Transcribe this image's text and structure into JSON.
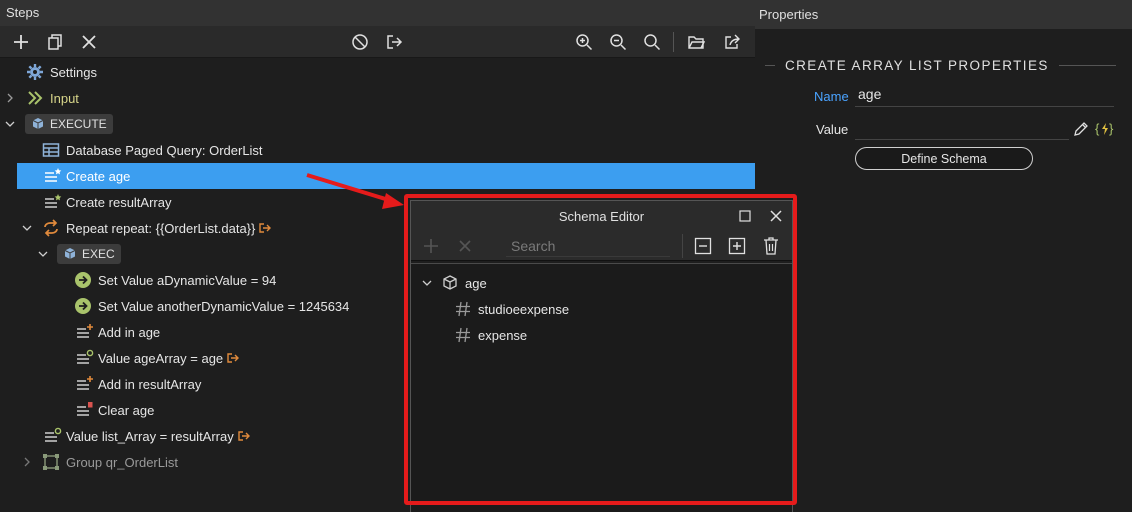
{
  "steps": {
    "title": "Steps",
    "toolbar": {
      "add": "plus-icon",
      "copy": "copy-icon",
      "delete": "close-icon",
      "disable": "disable-icon",
      "export": "export-icon",
      "zoom_in": "zoom-in-icon",
      "zoom_out": "zoom-out-icon",
      "zoom_fit": "zoom-fit-icon",
      "open": "folder-open-icon",
      "share": "share-icon"
    },
    "tree": [
      {
        "label": "Settings",
        "icon": "gear-icon"
      },
      {
        "label": "Input",
        "icon": "chevrons-icon"
      },
      {
        "label": "EXECUTE",
        "icon": "cube-icon"
      },
      {
        "label": "Database Paged Query: OrderList",
        "icon": "table-icon"
      },
      {
        "label": "Create age",
        "icon": "list-star-icon",
        "selected": true
      },
      {
        "label": "Create resultArray",
        "icon": "list-star-icon"
      },
      {
        "label": "Repeat repeat: {{OrderList.data}}",
        "icon": "repeat-icon"
      },
      {
        "label": "EXEC",
        "icon": "cube-icon"
      },
      {
        "label": "Set Value aDynamicValue = 94",
        "icon": "arrow-circle-icon"
      },
      {
        "label": "Set Value anotherDynamicValue = 1245634",
        "icon": "arrow-circle-icon"
      },
      {
        "label": "Add in age",
        "icon": "list-plus-icon"
      },
      {
        "label": "Value ageArray = age",
        "icon": "list-value-icon"
      },
      {
        "label": "Add in resultArray",
        "icon": "list-plus-icon"
      },
      {
        "label": "Clear age",
        "icon": "list-clear-icon"
      },
      {
        "label": "Value list_Array = resultArray",
        "icon": "list-value-icon"
      },
      {
        "label": "Group qr_OrderList",
        "icon": "group-icon"
      }
    ]
  },
  "properties": {
    "title": "Properties",
    "section_title": "CREATE ARRAY LIST PROPERTIES",
    "name_label": "Name",
    "name_value": "age",
    "value_label": "Value",
    "value_value": "",
    "define_schema_label": "Define Schema",
    "pencil": "pencil-icon",
    "binding": "dynamic-binding-icon"
  },
  "schema_editor": {
    "title": "Schema Editor",
    "search_placeholder": "Search",
    "tree": [
      {
        "label": "age",
        "icon": "cube-icon"
      },
      {
        "label": "studioeexpense",
        "icon": "hash-icon"
      },
      {
        "label": "expense",
        "icon": "hash-icon"
      }
    ]
  },
  "colors": {
    "selection": "#3c9ef0",
    "highlight": "#e51b1b",
    "accent_link": "#4aa3ff",
    "icon_green": "#a9c36b",
    "icon_orange": "#e08a3c"
  }
}
